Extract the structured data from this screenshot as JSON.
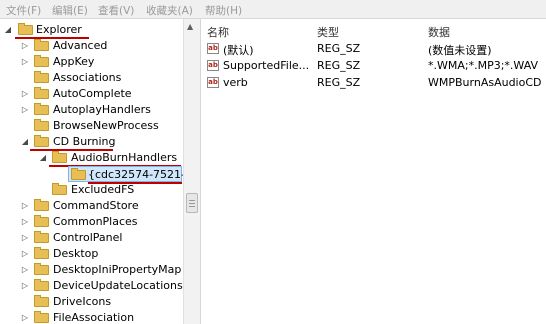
{
  "menu": {
    "items": [
      "文件(F)",
      "编辑(E)",
      "查看(V)",
      "收藏夹(A)",
      "帮助(H)"
    ]
  },
  "tree": {
    "nodes": [
      {
        "label": "Explorer",
        "expanded": true
      },
      {
        "label": "Advanced"
      },
      {
        "label": "AppKey"
      },
      {
        "label": "Associations"
      },
      {
        "label": "AutoComplete"
      },
      {
        "label": "AutoplayHandlers"
      },
      {
        "label": "BrowseNewProcess"
      },
      {
        "label": "CD Burning",
        "expanded": true
      },
      {
        "label": "AudioBurnHandlers",
        "expanded": true
      },
      {
        "label": "{cdc32574-7521-4",
        "selected": true
      },
      {
        "label": "ExcludedFS"
      },
      {
        "label": "CommandStore"
      },
      {
        "label": "CommonPlaces"
      },
      {
        "label": "ControlPanel"
      },
      {
        "label": "Desktop"
      },
      {
        "label": "DesktopIniPropertyMap"
      },
      {
        "label": "DeviceUpdateLocations"
      },
      {
        "label": "DriveIcons"
      },
      {
        "label": "FileAssociation"
      }
    ]
  },
  "list": {
    "columns": [
      "名称",
      "类型",
      "数据"
    ],
    "rows": [
      {
        "name": "(默认)",
        "type": "REG_SZ",
        "data": "(数值未设置)"
      },
      {
        "name": "SupportedFile...",
        "type": "REG_SZ",
        "data": "*.WMA;*.MP3;*.WAV"
      },
      {
        "name": "verb",
        "type": "REG_SZ",
        "data": "WMPBurnAsAudioCD"
      }
    ]
  },
  "colors": {
    "highlight_underline": "#c00000",
    "folder": "#e8bf57",
    "selection": "#cfe6fb"
  },
  "icons": {
    "tree_node": "folder-icon",
    "value_row": "registry-string-icon"
  }
}
